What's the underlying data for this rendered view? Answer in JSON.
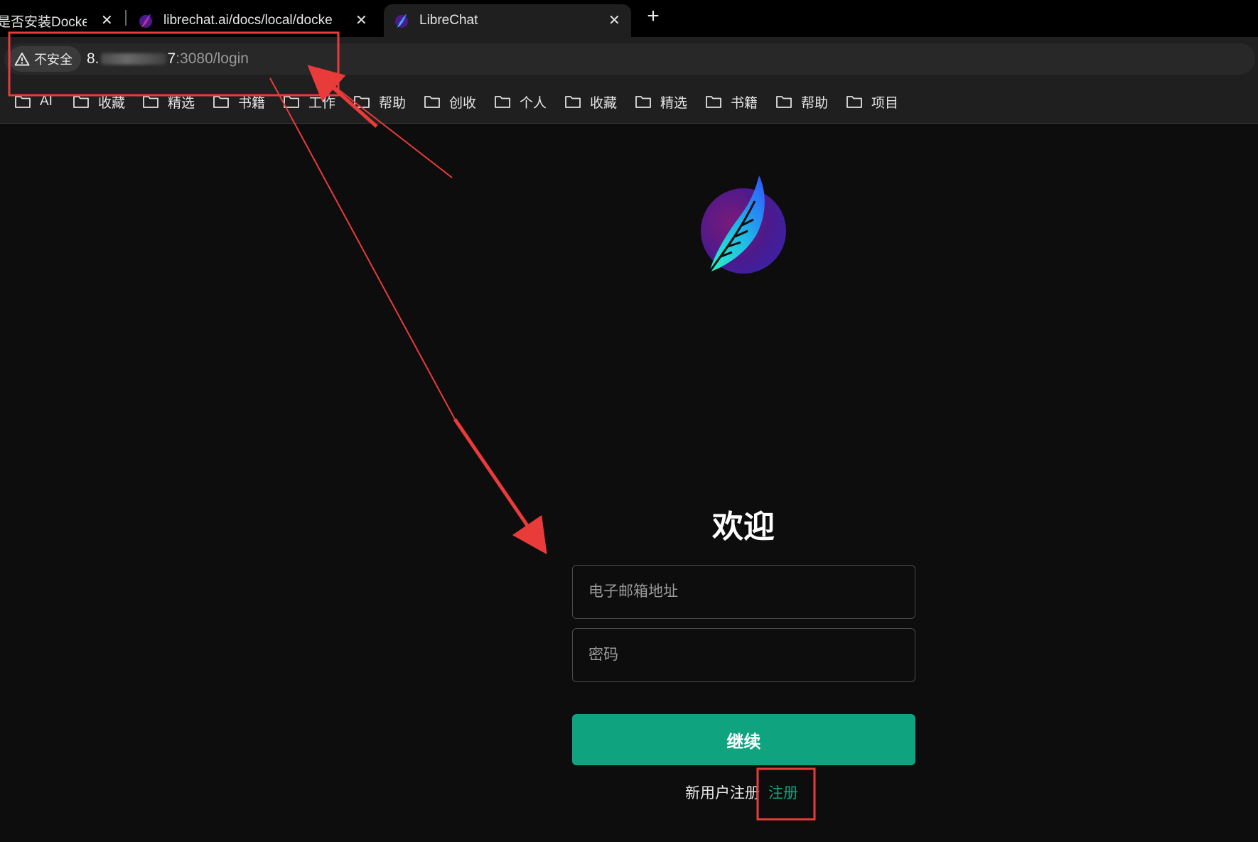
{
  "browser": {
    "tabs": [
      {
        "title": "是否安装Docker",
        "active": false
      },
      {
        "title": "librechat.ai/docs/local/docke",
        "active": false
      },
      {
        "title": "LibreChat",
        "active": true
      }
    ],
    "close_glyph": "✕",
    "new_tab_glyph": "+",
    "security_label": "不安全",
    "url": {
      "host_start": "8.",
      "host_end": "7",
      "port": ":3080",
      "path": "/login"
    },
    "bookmarks": [
      "AI",
      "收藏",
      "精选",
      "书籍",
      "工作",
      "帮助",
      "创收",
      "个人",
      "收藏",
      "精选",
      "书籍",
      "帮助",
      "项目"
    ]
  },
  "login": {
    "title": "欢迎",
    "email_placeholder": "电子邮箱地址",
    "password_placeholder": "密码",
    "continue_label": "继续",
    "new_user_text": "新用户注册",
    "signup_link": "注册"
  },
  "annotation": {
    "color": "#ea3b3b"
  },
  "colors": {
    "accent": "#10a37f",
    "page_bg": "#0d0d0d",
    "chrome_bg": "#1f1f1f"
  }
}
